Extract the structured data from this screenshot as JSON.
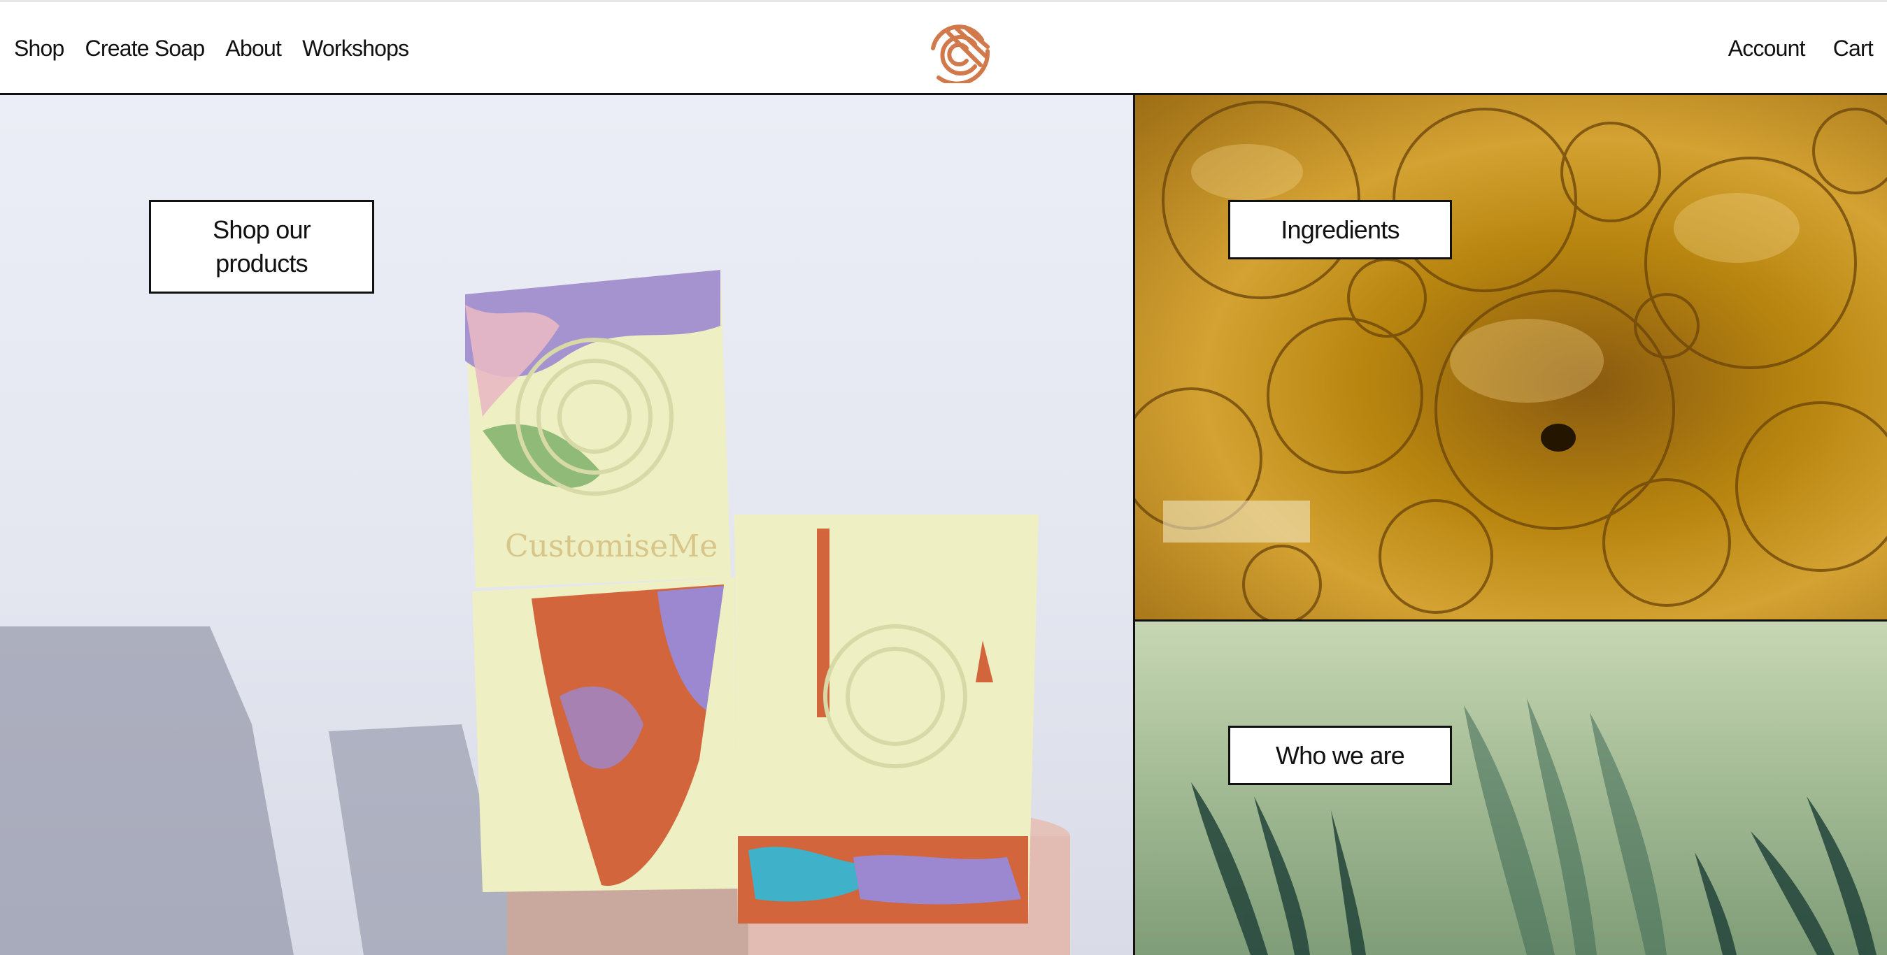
{
  "nav": {
    "left": [
      {
        "label": "Shop"
      },
      {
        "label": "Create Soap"
      },
      {
        "label": "About"
      },
      {
        "label": "Workshops"
      }
    ],
    "right": [
      {
        "label": "Account"
      },
      {
        "label": "Cart"
      }
    ],
    "logo": {
      "icon": "fingerprint-c-logo-icon",
      "color": "#d2794c"
    }
  },
  "panels": {
    "shop": {
      "label": "Shop our products",
      "line1": "Shop our",
      "line2": "products"
    },
    "ingredients": {
      "label": "Ingredients"
    },
    "who": {
      "label": "Who we are"
    }
  },
  "images": {
    "soap_bars": {
      "brand_text": "CustomiseMe"
    }
  },
  "colors": {
    "text": "#111111",
    "border": "#111111",
    "accent": "#d2794c"
  }
}
